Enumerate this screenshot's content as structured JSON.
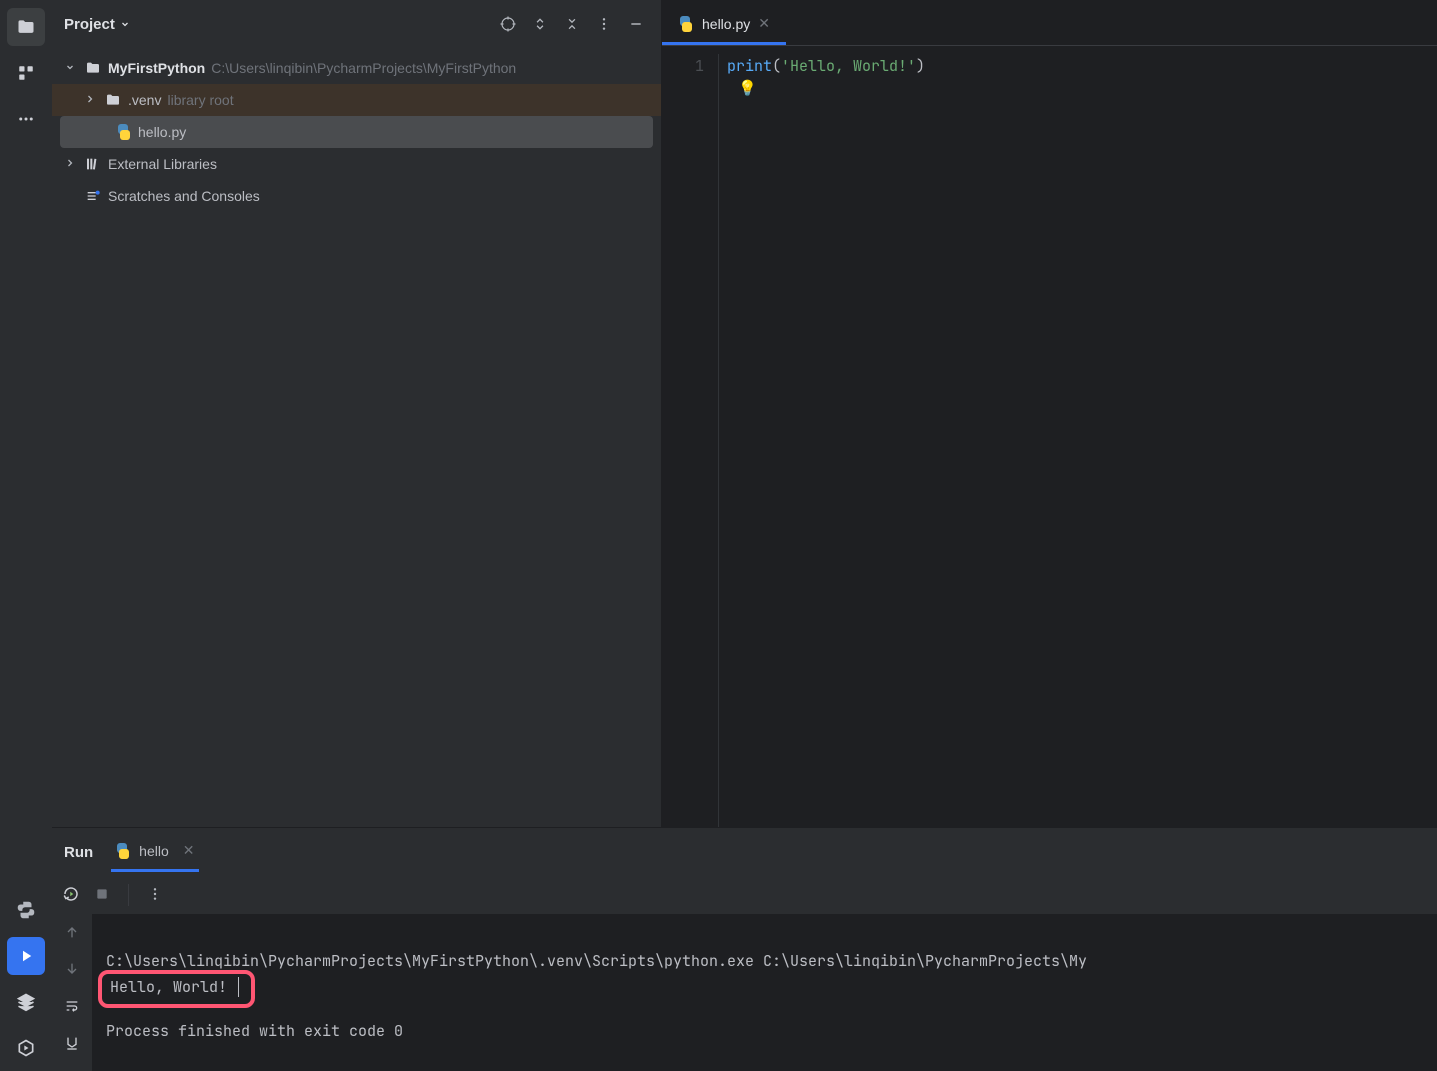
{
  "project": {
    "panel_title": "Project",
    "root_name": "MyFirstPython",
    "root_path": "C:\\Users\\linqibin\\PycharmProjects\\MyFirstPython",
    "venv_name": ".venv",
    "venv_hint": "library root",
    "file_name": "hello.py",
    "external_libraries": "External Libraries",
    "scratches": "Scratches and Consoles"
  },
  "editor": {
    "tab_label": "hello.py",
    "line_number": "1",
    "code_fn": "print",
    "code_open": "(",
    "code_str": "'Hello, World!'",
    "code_close": ")"
  },
  "run": {
    "title": "Run",
    "tab_label": "hello",
    "lines": {
      "cmd": "C:\\Users\\linqibin\\PycharmProjects\\MyFirstPython\\.venv\\Scripts\\python.exe C:\\Users\\linqibin\\PycharmProjects\\My",
      "output": "Hello, World!",
      "exit": "Process finished with exit code 0"
    }
  }
}
